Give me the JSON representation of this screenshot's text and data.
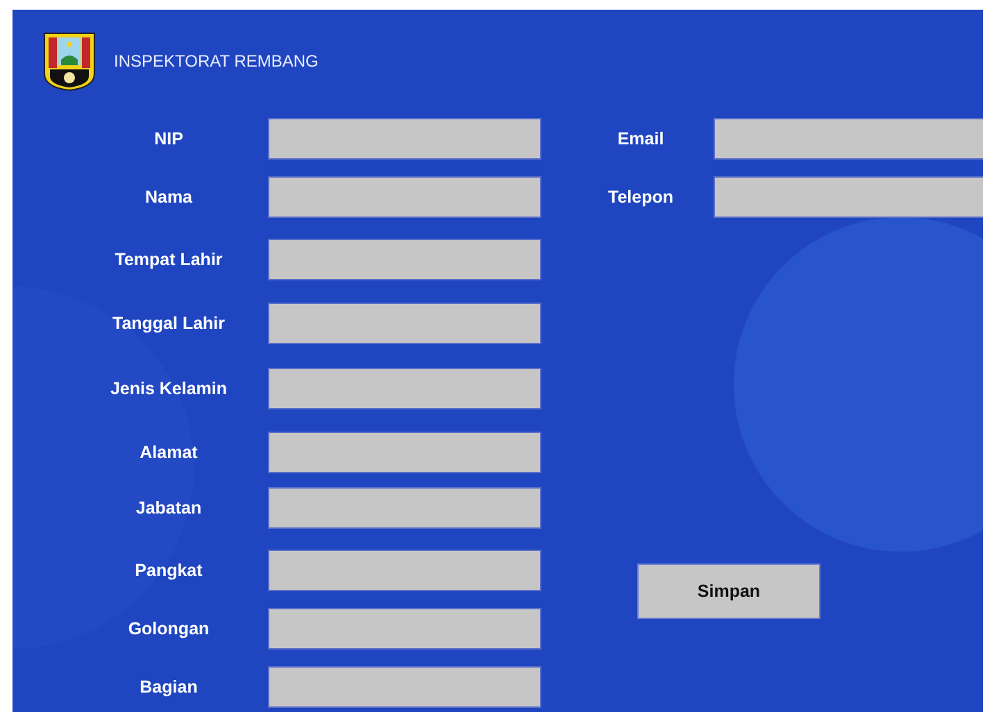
{
  "header": {
    "title": "INSPEKTORAT REMBANG"
  },
  "left_fields": [
    {
      "label": "NIP"
    },
    {
      "label": "Nama"
    },
    {
      "label": "Tempat Lahir"
    },
    {
      "label": "Tanggal Lahir"
    },
    {
      "label": "Jenis Kelamin"
    },
    {
      "label": "Alamat"
    },
    {
      "label": "Jabatan"
    },
    {
      "label": "Pangkat"
    },
    {
      "label": "Golongan"
    },
    {
      "label": "Bagian"
    }
  ],
  "right_fields": [
    {
      "label": "Email"
    },
    {
      "label": "Telepon"
    }
  ],
  "buttons": [
    {
      "label": "Simpan"
    }
  ]
}
